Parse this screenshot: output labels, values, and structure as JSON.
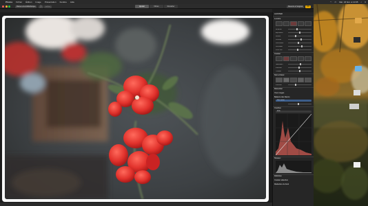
{
  "menubar": {
    "app_name": "Photos",
    "items": [
      "Fichier",
      "Édition",
      "Image",
      "Présentation",
      "Fenêtre",
      "Aide"
    ],
    "status_right": [
      "Mar. 23 févr. à 10:35"
    ]
  },
  "toolbar": {
    "left_buttons": [
      "Retour à la bibliothèque"
    ],
    "mode_tabs": [
      "Ajuster",
      "Filtres",
      "Recadrer"
    ],
    "active_mode": 0,
    "right_buttons": [
      "Revenir à l'original",
      "OK"
    ]
  },
  "panel": {
    "title": "AJUSTER",
    "sections": [
      {
        "name": "Lumière",
        "sliders": [
          "Brillance",
          "Exposition",
          "Reflets",
          "Ombres",
          "Luminosité",
          "Contraste",
          "Point noir"
        ]
      },
      {
        "name": "Couleur",
        "sliders": [
          "Saturation",
          "Intensité",
          "Tonalité"
        ]
      },
      {
        "name": "Noir et blanc",
        "sliders": [
          "Intensité"
        ]
      },
      {
        "name": "Retoucher"
      },
      {
        "name": "Yeux rouges"
      },
      {
        "name": "Balance des blancs",
        "selected": "Gris neutre"
      },
      {
        "name": "Courbes"
      },
      {
        "name": "Niveaux"
      },
      {
        "name": "Définition"
      },
      {
        "name": "Couleur sélective"
      },
      {
        "name": "Réduction du bruit"
      }
    ],
    "curves_value": "RVB"
  },
  "desktop": {
    "icons": [
      {
        "name": "Capture d'écran",
        "color": "#5b8ed6"
      },
      {
        "name": "Dossier",
        "color": "#6cb3e6"
      },
      {
        "name": "Document",
        "color": "#dddddd"
      }
    ]
  },
  "colors": {
    "accent": "#e0a400",
    "menu_bg": "#2a2a2a",
    "panel_bg": "#262626",
    "flower": "#e23a32"
  }
}
